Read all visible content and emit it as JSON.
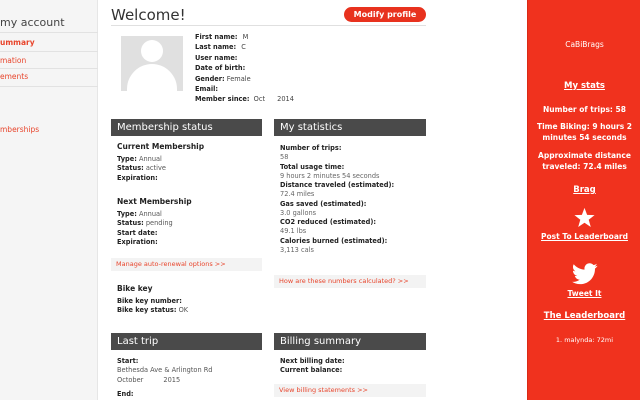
{
  "nav": {
    "title": "my account",
    "items": [
      "ummary",
      "mation",
      "ements",
      "mberships"
    ]
  },
  "header": {
    "welcome": "Welcome!",
    "modify_button": "Modify profile"
  },
  "profile": {
    "first_name_label": "First name:",
    "first_name": "M",
    "last_name_label": "Last name:",
    "last_name": "C",
    "user_name_label": "User name:",
    "user_name": "",
    "dob_label": "Date of birth:",
    "dob": "",
    "gender_label": "Gender:",
    "gender": "Female",
    "email_label": "Email:",
    "email": "",
    "member_since_label": "Member since:",
    "member_since": "Oct",
    "member_since_year": "2014"
  },
  "membership": {
    "title": "Membership status",
    "current_title": "Current Membership",
    "current_type_label": "Type:",
    "current_type": "Annual",
    "current_status_label": "Status:",
    "current_status": "active",
    "current_expiration_label": "Expiration:",
    "current_expiration": "",
    "next_title": "Next Membership",
    "next_type_label": "Type:",
    "next_type": "Annual",
    "next_status_label": "Status:",
    "next_status": "pending",
    "next_start_label": "Start date:",
    "next_start": "",
    "next_expiration_label": "Expiration:",
    "next_expiration": "",
    "auto_renewal_link": "Manage auto-renewal options >>",
    "bike_key_title": "Bike key",
    "bike_key_number_label": "Bike key number:",
    "bike_key_number": "",
    "bike_key_status_label": "Bike key status:",
    "bike_key_status": "OK"
  },
  "stats": {
    "title": "My statistics",
    "trips_label": "Number of trips:",
    "trips": "58",
    "usage_label": "Total usage time:",
    "usage": "9 hours 2 minutes 54 seconds",
    "distance_label": "Distance traveled (estimated):",
    "distance": "72.4 miles",
    "gas_label": "Gas saved (estimated):",
    "gas": "3.0 gallons",
    "co2_label": "CO2 reduced (estimated):",
    "co2": "49.1 lbs",
    "calories_label": "Calories burned (estimated):",
    "calories": "3,113 cals",
    "calc_link": "How are these numbers calculated? >>"
  },
  "last_trip": {
    "title": "Last trip",
    "start_label": "Start:",
    "start_location": "Bethesda Ave & Arlington Rd",
    "start_month": "October",
    "start_year": "2015",
    "end_label": "End:"
  },
  "billing": {
    "title": "Billing summary",
    "next_billing_label": "Next billing date:",
    "next_billing": "",
    "balance_label": "Current balance:",
    "balance": "",
    "statements_link": "View billing statements >>"
  },
  "sidebar": {
    "brand": "CaBiBrags",
    "my_stats": "My stats",
    "trips_line": "Number of trips: 58",
    "time_line1": "Time Biking: 9 hours 2",
    "time_line2": "minutes 54 seconds",
    "dist_line1": "Approximate distance",
    "dist_line2": "traveled: 72.4 miles",
    "brag": "Brag",
    "leaderboard_post": "Post To Leaderboard",
    "tweet": "Tweet It",
    "leaderboard": "The Leaderboard",
    "leaderboard_entry": "1. malynda: 72mi"
  },
  "colors": {
    "accent": "#f0321e",
    "panel_header": "#4a4a4a",
    "link": "#e8452c"
  },
  "icons": {
    "star": "star-icon",
    "bird": "twitter-bird-icon"
  }
}
